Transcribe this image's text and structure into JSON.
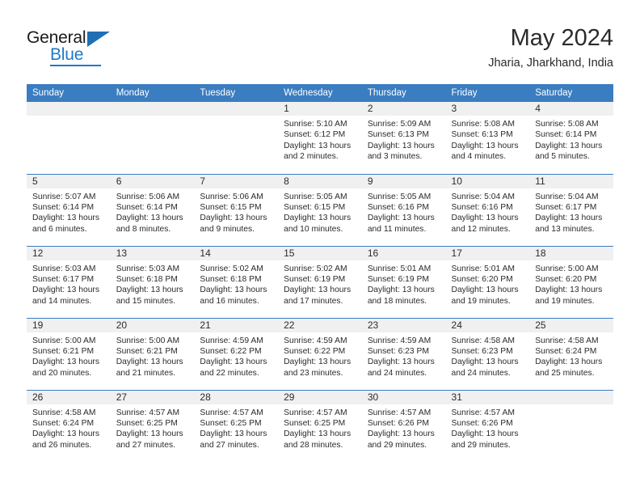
{
  "brand": {
    "name_part1": "General",
    "name_part2": "Blue",
    "logo_icon": "blue-triangle-icon",
    "accent_color": "#2079c6"
  },
  "header": {
    "title": "May 2024",
    "subtitle": "Jharia, Jharkhand, India"
  },
  "calendar": {
    "header_bg": "#3a7dc0",
    "daynum_bg": "#f0f0f0",
    "weekdays": [
      "Sunday",
      "Monday",
      "Tuesday",
      "Wednesday",
      "Thursday",
      "Friday",
      "Saturday"
    ],
    "weeks": [
      [
        {
          "day": "",
          "sunrise": "",
          "sunset": "",
          "daylight1": "",
          "daylight2": ""
        },
        {
          "day": "",
          "sunrise": "",
          "sunset": "",
          "daylight1": "",
          "daylight2": ""
        },
        {
          "day": "",
          "sunrise": "",
          "sunset": "",
          "daylight1": "",
          "daylight2": ""
        },
        {
          "day": "1",
          "sunrise": "Sunrise: 5:10 AM",
          "sunset": "Sunset: 6:12 PM",
          "daylight1": "Daylight: 13 hours",
          "daylight2": "and 2 minutes."
        },
        {
          "day": "2",
          "sunrise": "Sunrise: 5:09 AM",
          "sunset": "Sunset: 6:13 PM",
          "daylight1": "Daylight: 13 hours",
          "daylight2": "and 3 minutes."
        },
        {
          "day": "3",
          "sunrise": "Sunrise: 5:08 AM",
          "sunset": "Sunset: 6:13 PM",
          "daylight1": "Daylight: 13 hours",
          "daylight2": "and 4 minutes."
        },
        {
          "day": "4",
          "sunrise": "Sunrise: 5:08 AM",
          "sunset": "Sunset: 6:14 PM",
          "daylight1": "Daylight: 13 hours",
          "daylight2": "and 5 minutes."
        }
      ],
      [
        {
          "day": "5",
          "sunrise": "Sunrise: 5:07 AM",
          "sunset": "Sunset: 6:14 PM",
          "daylight1": "Daylight: 13 hours",
          "daylight2": "and 6 minutes."
        },
        {
          "day": "6",
          "sunrise": "Sunrise: 5:06 AM",
          "sunset": "Sunset: 6:14 PM",
          "daylight1": "Daylight: 13 hours",
          "daylight2": "and 8 minutes."
        },
        {
          "day": "7",
          "sunrise": "Sunrise: 5:06 AM",
          "sunset": "Sunset: 6:15 PM",
          "daylight1": "Daylight: 13 hours",
          "daylight2": "and 9 minutes."
        },
        {
          "day": "8",
          "sunrise": "Sunrise: 5:05 AM",
          "sunset": "Sunset: 6:15 PM",
          "daylight1": "Daylight: 13 hours",
          "daylight2": "and 10 minutes."
        },
        {
          "day": "9",
          "sunrise": "Sunrise: 5:05 AM",
          "sunset": "Sunset: 6:16 PM",
          "daylight1": "Daylight: 13 hours",
          "daylight2": "and 11 minutes."
        },
        {
          "day": "10",
          "sunrise": "Sunrise: 5:04 AM",
          "sunset": "Sunset: 6:16 PM",
          "daylight1": "Daylight: 13 hours",
          "daylight2": "and 12 minutes."
        },
        {
          "day": "11",
          "sunrise": "Sunrise: 5:04 AM",
          "sunset": "Sunset: 6:17 PM",
          "daylight1": "Daylight: 13 hours",
          "daylight2": "and 13 minutes."
        }
      ],
      [
        {
          "day": "12",
          "sunrise": "Sunrise: 5:03 AM",
          "sunset": "Sunset: 6:17 PM",
          "daylight1": "Daylight: 13 hours",
          "daylight2": "and 14 minutes."
        },
        {
          "day": "13",
          "sunrise": "Sunrise: 5:03 AM",
          "sunset": "Sunset: 6:18 PM",
          "daylight1": "Daylight: 13 hours",
          "daylight2": "and 15 minutes."
        },
        {
          "day": "14",
          "sunrise": "Sunrise: 5:02 AM",
          "sunset": "Sunset: 6:18 PM",
          "daylight1": "Daylight: 13 hours",
          "daylight2": "and 16 minutes."
        },
        {
          "day": "15",
          "sunrise": "Sunrise: 5:02 AM",
          "sunset": "Sunset: 6:19 PM",
          "daylight1": "Daylight: 13 hours",
          "daylight2": "and 17 minutes."
        },
        {
          "day": "16",
          "sunrise": "Sunrise: 5:01 AM",
          "sunset": "Sunset: 6:19 PM",
          "daylight1": "Daylight: 13 hours",
          "daylight2": "and 18 minutes."
        },
        {
          "day": "17",
          "sunrise": "Sunrise: 5:01 AM",
          "sunset": "Sunset: 6:20 PM",
          "daylight1": "Daylight: 13 hours",
          "daylight2": "and 19 minutes."
        },
        {
          "day": "18",
          "sunrise": "Sunrise: 5:00 AM",
          "sunset": "Sunset: 6:20 PM",
          "daylight1": "Daylight: 13 hours",
          "daylight2": "and 19 minutes."
        }
      ],
      [
        {
          "day": "19",
          "sunrise": "Sunrise: 5:00 AM",
          "sunset": "Sunset: 6:21 PM",
          "daylight1": "Daylight: 13 hours",
          "daylight2": "and 20 minutes."
        },
        {
          "day": "20",
          "sunrise": "Sunrise: 5:00 AM",
          "sunset": "Sunset: 6:21 PM",
          "daylight1": "Daylight: 13 hours",
          "daylight2": "and 21 minutes."
        },
        {
          "day": "21",
          "sunrise": "Sunrise: 4:59 AM",
          "sunset": "Sunset: 6:22 PM",
          "daylight1": "Daylight: 13 hours",
          "daylight2": "and 22 minutes."
        },
        {
          "day": "22",
          "sunrise": "Sunrise: 4:59 AM",
          "sunset": "Sunset: 6:22 PM",
          "daylight1": "Daylight: 13 hours",
          "daylight2": "and 23 minutes."
        },
        {
          "day": "23",
          "sunrise": "Sunrise: 4:59 AM",
          "sunset": "Sunset: 6:23 PM",
          "daylight1": "Daylight: 13 hours",
          "daylight2": "and 24 minutes."
        },
        {
          "day": "24",
          "sunrise": "Sunrise: 4:58 AM",
          "sunset": "Sunset: 6:23 PM",
          "daylight1": "Daylight: 13 hours",
          "daylight2": "and 24 minutes."
        },
        {
          "day": "25",
          "sunrise": "Sunrise: 4:58 AM",
          "sunset": "Sunset: 6:24 PM",
          "daylight1": "Daylight: 13 hours",
          "daylight2": "and 25 minutes."
        }
      ],
      [
        {
          "day": "26",
          "sunrise": "Sunrise: 4:58 AM",
          "sunset": "Sunset: 6:24 PM",
          "daylight1": "Daylight: 13 hours",
          "daylight2": "and 26 minutes."
        },
        {
          "day": "27",
          "sunrise": "Sunrise: 4:57 AM",
          "sunset": "Sunset: 6:25 PM",
          "daylight1": "Daylight: 13 hours",
          "daylight2": "and 27 minutes."
        },
        {
          "day": "28",
          "sunrise": "Sunrise: 4:57 AM",
          "sunset": "Sunset: 6:25 PM",
          "daylight1": "Daylight: 13 hours",
          "daylight2": "and 27 minutes."
        },
        {
          "day": "29",
          "sunrise": "Sunrise: 4:57 AM",
          "sunset": "Sunset: 6:25 PM",
          "daylight1": "Daylight: 13 hours",
          "daylight2": "and 28 minutes."
        },
        {
          "day": "30",
          "sunrise": "Sunrise: 4:57 AM",
          "sunset": "Sunset: 6:26 PM",
          "daylight1": "Daylight: 13 hours",
          "daylight2": "and 29 minutes."
        },
        {
          "day": "31",
          "sunrise": "Sunrise: 4:57 AM",
          "sunset": "Sunset: 6:26 PM",
          "daylight1": "Daylight: 13 hours",
          "daylight2": "and 29 minutes."
        },
        {
          "day": "",
          "sunrise": "",
          "sunset": "",
          "daylight1": "",
          "daylight2": ""
        }
      ]
    ]
  }
}
